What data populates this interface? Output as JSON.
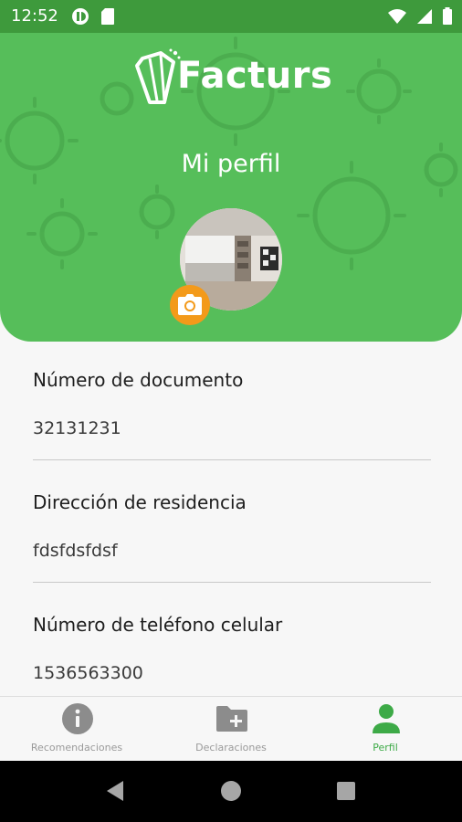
{
  "status_bar": {
    "time": "12:52",
    "icons": [
      "podcast-icon",
      "sd-card-icon",
      "wifi-icon",
      "signal-icon",
      "battery-icon"
    ]
  },
  "header": {
    "brand": "Facturs",
    "title": "Mi perfil",
    "accent_color": "#56be5a",
    "camera_color": "#f39a1a"
  },
  "profile": {
    "fields": [
      {
        "label": "Número de documento",
        "value": "32131231"
      },
      {
        "label": "Dirección de residencia",
        "value": "fdsfdsfdsf"
      },
      {
        "label": "Número de teléfono celular",
        "value": "1536563300"
      }
    ]
  },
  "bottom_nav": {
    "items": [
      {
        "label": "Recomendaciones",
        "icon": "info-icon",
        "active": false
      },
      {
        "label": "Declaraciones",
        "icon": "folder-add-icon",
        "active": false
      },
      {
        "label": "Perfil",
        "icon": "person-icon",
        "active": true
      }
    ],
    "active_color": "#3daa47"
  },
  "system_nav": {
    "buttons": [
      "back-icon",
      "home-icon",
      "recents-icon"
    ]
  }
}
